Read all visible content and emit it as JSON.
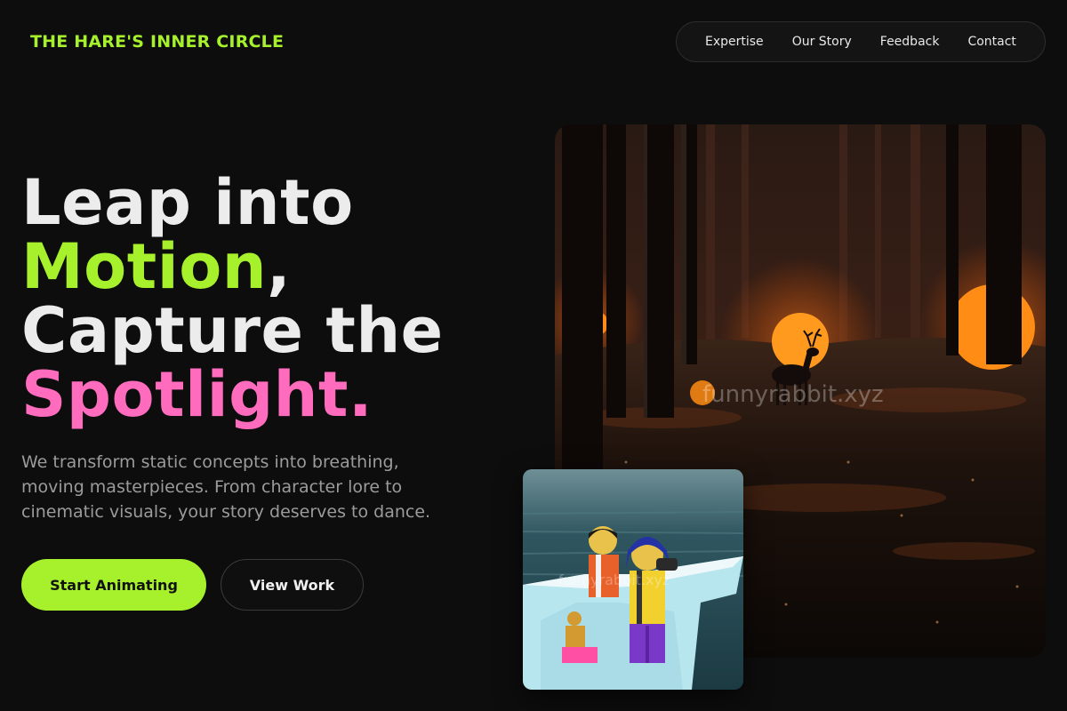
{
  "brand": {
    "name": "THE HARE'S INNER CIRCLE"
  },
  "nav": {
    "items": [
      {
        "label": "Expertise"
      },
      {
        "label": "Our Story"
      },
      {
        "label": "Feedback"
      },
      {
        "label": "Contact"
      }
    ]
  },
  "hero": {
    "line1": "Leap into",
    "line2_highlight": "Motion",
    "line2_rest": ",",
    "line3": "Capture the",
    "line4": "Spotlight.",
    "description": "We transform static concepts into breathing, moving masterpieces. From character lore to cinematic visuals, your story deserves to dance.",
    "primary_cta": "Start Animating",
    "secondary_cta": "View Work"
  },
  "images": {
    "main": {
      "icon": "forest-deer-image",
      "watermark": "funnyrabbit.xyz"
    },
    "small": {
      "icon": "lego-boat-image",
      "watermark": "funnyrabbit.xyz"
    }
  },
  "colors": {
    "accent_green": "#a6f12c",
    "accent_pink": "#ff6bbd",
    "background": "#0d0d0d"
  }
}
